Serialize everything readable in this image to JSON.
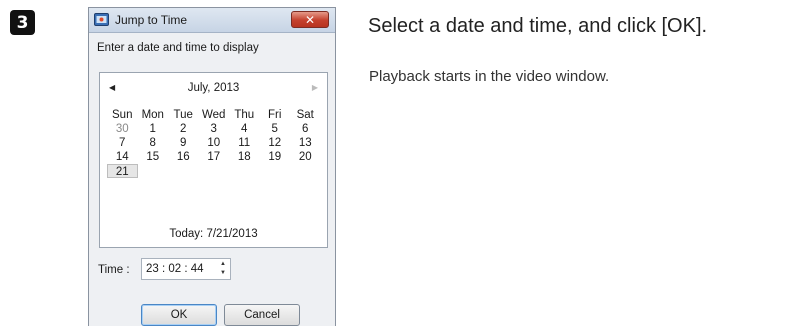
{
  "step": {
    "number": "3"
  },
  "dialog": {
    "title": "Jump to Time",
    "close_symbol": "✕",
    "prompt": "Enter a date and time to display",
    "calendar": {
      "prev_symbol": "◀",
      "next_symbol": "▶",
      "month": "July, 2013",
      "weekdays": [
        "Sun",
        "Mon",
        "Tue",
        "Wed",
        "Thu",
        "Fri",
        "Sat"
      ],
      "rows": [
        [
          "30",
          "1",
          "2",
          "3",
          "4",
          "5",
          "6"
        ],
        [
          "7",
          "8",
          "9",
          "10",
          "11",
          "12",
          "13"
        ],
        [
          "14",
          "15",
          "16",
          "17",
          "18",
          "19",
          "20"
        ],
        [
          "21",
          "",
          "",
          "",
          "",
          "",
          ""
        ]
      ],
      "today_label": "Today: 7/21/2013"
    },
    "time_label": "Time :",
    "time_value": "23 : 02 : 44",
    "spin_up": "▲",
    "spin_down": "▼",
    "ok_label": "OK",
    "cancel_label": "Cancel"
  },
  "instructions": {
    "title": "Select a date and time, and click [OK].",
    "subtitle": "Playback starts in the video window."
  }
}
